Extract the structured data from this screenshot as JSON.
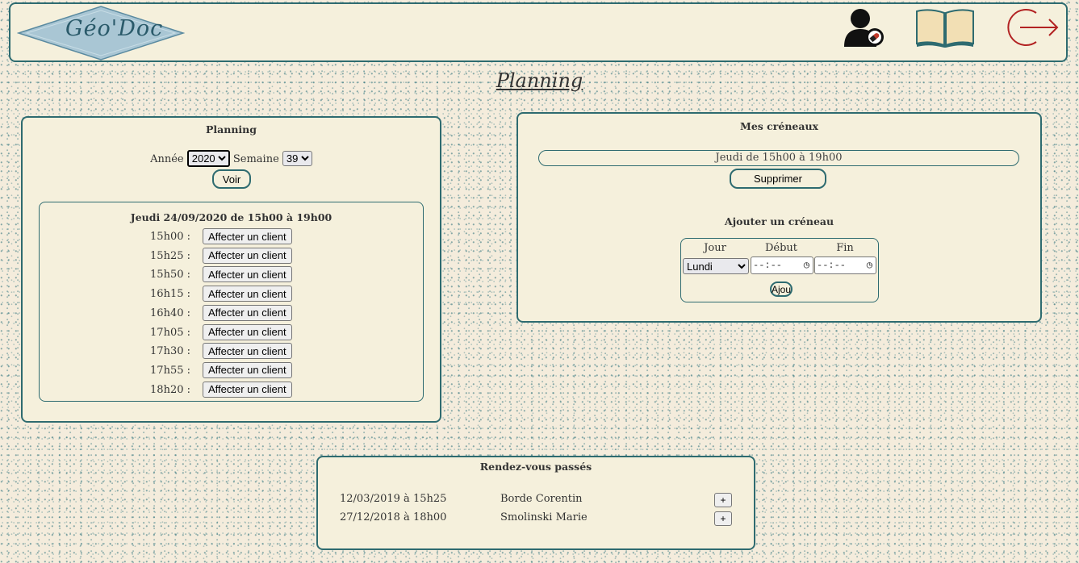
{
  "header": {
    "logo_text": "Géo'Doc",
    "icons": [
      "user-settings-icon",
      "book-icon",
      "logout-icon"
    ]
  },
  "page_title": "Planning",
  "planning": {
    "title": "Planning",
    "year_label": "Année",
    "year_value": "2020",
    "week_label": "Semaine",
    "week_value": "39",
    "view_button": "Voir",
    "day_title": "Jeudi 24/09/2020 de 15h00 à 19h00",
    "assign_label": "Affecter un client",
    "slots": [
      "15h00 :",
      "15h25 :",
      "15h50 :",
      "16h15 :",
      "16h40 :",
      "17h05 :",
      "17h30 :",
      "17h55 :",
      "18h20 :"
    ]
  },
  "creneaux": {
    "title": "Mes créneaux",
    "slot_text": "Jeudi de 15h00 à 19h00",
    "delete_button": "Supprimer",
    "add_title": "Ajouter un créneau",
    "col_day": "Jour",
    "col_start": "Début",
    "col_end": "Fin",
    "day_value": "Lundi",
    "time_placeholder": "--:--",
    "add_button": "Ajou"
  },
  "past": {
    "title": "Rendez-vous passés",
    "expand_label": "+",
    "rows": [
      {
        "date": "12/03/2019 à 15h25",
        "name": "Borde Corentin"
      },
      {
        "date": "27/12/2018 à 18h00",
        "name": "Smolinski Marie"
      }
    ]
  },
  "colors": {
    "accent": "#2e6b70",
    "panel": "#f5f0dc",
    "logout": "#b22222"
  }
}
